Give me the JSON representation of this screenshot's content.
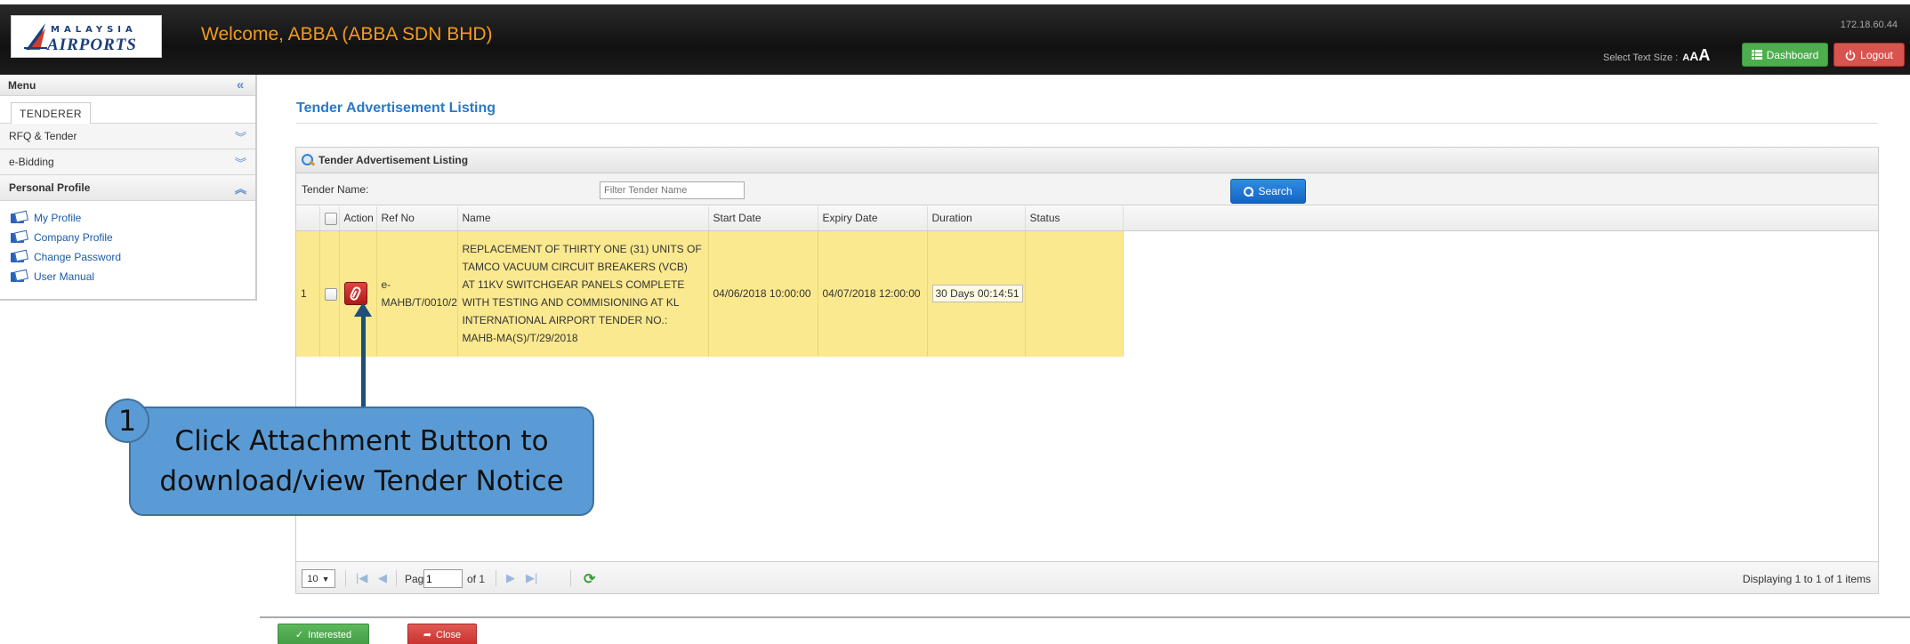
{
  "header": {
    "logo_line1": "MALAYSIA",
    "logo_line2": "AIRPORTS",
    "welcome": "Welcome, ABBA  (ABBA SDN BHD)",
    "ip": "172.18.60.44",
    "text_size_label": "Select Text Size :",
    "text_size_options": [
      "A",
      "A",
      "A"
    ],
    "dashboard_label": "Dashboard",
    "logout_label": "Logout"
  },
  "sidebar": {
    "menu_label": "Menu",
    "tab_label": "TENDERER",
    "sections": [
      {
        "label": "RFQ & Tender"
      },
      {
        "label": "e-Bidding"
      },
      {
        "label": "Personal Profile"
      }
    ],
    "links": [
      {
        "label": "My Profile"
      },
      {
        "label": "Company Profile"
      },
      {
        "label": "Change Password"
      },
      {
        "label": "User Manual"
      }
    ]
  },
  "main": {
    "page_title": "Tender Advertisement Listing",
    "panel_title": "Tender Advertisement Listing",
    "filter_label": "Tender Name:",
    "filter_placeholder": "Filter Tender Name",
    "search_label": "Search",
    "columns": [
      "Action",
      "Ref No",
      "Name",
      "Start Date",
      "Expiry Date",
      "Duration",
      "Status"
    ],
    "rows": [
      {
        "num": "1",
        "ref_line1": "e-",
        "ref_line2": "MAHB/T/0010/2",
        "name": "REPLACEMENT OF THIRTY ONE (31) UNITS OF TAMCO VACUUM CIRCUIT BREAKERS (VCB) AT 11KV SWITCHGEAR PANELS COMPLETE WITH TESTING AND COMMISIONING AT KL INTERNATIONAL AIRPORT TENDER NO.: MAHB-MA(S)/T/29/2018",
        "start_date": "04/06/2018 10:00:00",
        "expiry_date": "04/07/2018 12:00:00",
        "duration": "30 Days 00:14:51",
        "status": ""
      }
    ],
    "pager": {
      "page_size": "10",
      "page_label": "Page",
      "page_value": "1",
      "of_label": "of 1",
      "displaying": "Displaying 1 to 1 of 1 items"
    }
  },
  "footer": {
    "interested_label": "Interested",
    "close_label": "Close"
  },
  "annotation": {
    "step_number": "1",
    "text_line1": "Click Attachment Button to",
    "text_line2": "download/view Tender Notice"
  },
  "colors": {
    "header_bg": "#1b1b1b",
    "welcome": "#f39a1d",
    "title_blue": "#2a79c7",
    "row_highlight": "#fbe98f",
    "callout": "#5b9bd5"
  }
}
